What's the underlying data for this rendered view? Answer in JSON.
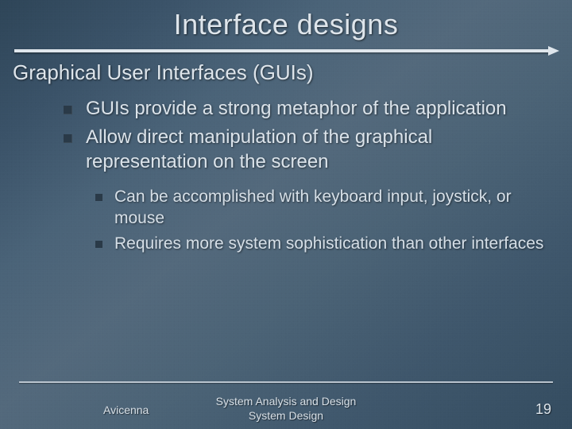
{
  "title": "Interface designs",
  "subtitle": "Graphical User Interfaces (GUIs)",
  "bullets_lvl1": [
    "GUIs provide a strong metaphor of the application",
    "Allow direct manipulation of the graphical representation on the screen"
  ],
  "bullets_lvl2": [
    "Can be accomplished with keyboard input, joystick, or mouse",
    "Requires more system sophistication than other interfaces"
  ],
  "footer": {
    "left": "Avicenna",
    "center_line1": "System Analysis and Design",
    "center_line2": "System Design",
    "page": "19"
  }
}
